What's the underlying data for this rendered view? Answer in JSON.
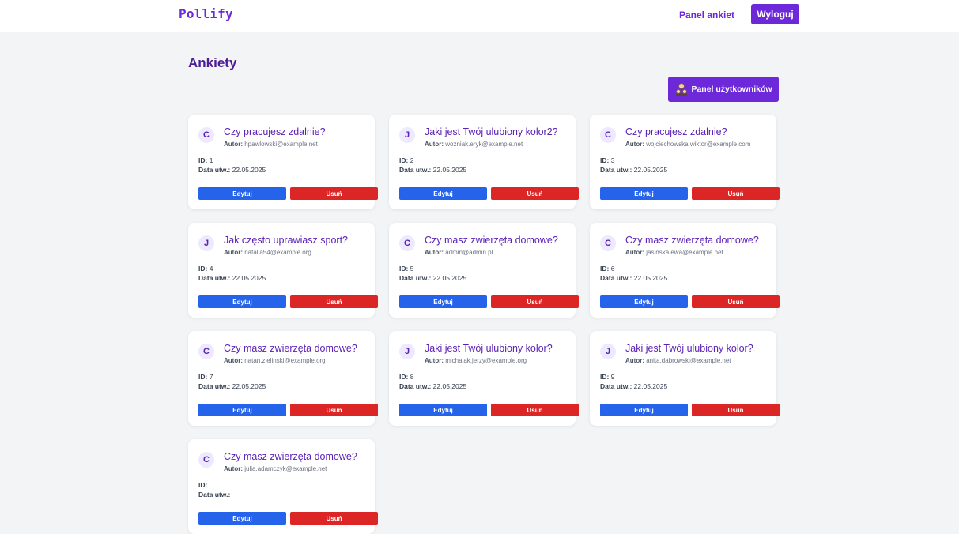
{
  "brand": "Pollify",
  "nav": {
    "panel_link": "Panel ankiet",
    "logout": "Wyloguj"
  },
  "page_title": "Ankiety",
  "users_button": "Panel użytkowników",
  "labels": {
    "author": "Autor:",
    "id": "ID:",
    "created": "Data utw.:",
    "edit": "Edytuj",
    "delete": "Usuń"
  },
  "colors": {
    "accent": "#6d28d9",
    "edit": "#2563eb",
    "delete": "#dc2626"
  },
  "surveys": [
    {
      "initial": "C",
      "title": "Czy pracujesz zdalnie?",
      "author": "hpawlowski@example.net",
      "id": "1",
      "created": "22.05.2025"
    },
    {
      "initial": "J",
      "title": "Jaki jest Twój ulubiony kolor2?",
      "author": "wozniak.eryk@example.net",
      "id": "2",
      "created": "22.05.2025"
    },
    {
      "initial": "C",
      "title": "Czy pracujesz zdalnie?",
      "author": "wojciechowska.wiktor@example.com",
      "id": "3",
      "created": "22.05.2025"
    },
    {
      "initial": "J",
      "title": "Jak często uprawiasz sport?",
      "author": "natalia54@example.org",
      "id": "4",
      "created": "22.05.2025"
    },
    {
      "initial": "C",
      "title": "Czy masz zwierzęta domowe?",
      "author": "admin@admin.pl",
      "id": "5",
      "created": "22.05.2025"
    },
    {
      "initial": "C",
      "title": "Czy masz zwierzęta domowe?",
      "author": "jasinska.ewa@example.net",
      "id": "6",
      "created": "22.05.2025"
    },
    {
      "initial": "C",
      "title": "Czy masz zwierzęta domowe?",
      "author": "natan.zielinski@example.org",
      "id": "7",
      "created": "22.05.2025"
    },
    {
      "initial": "J",
      "title": "Jaki jest Twój ulubiony kolor?",
      "author": "michalak.jerzy@example.org",
      "id": "8",
      "created": "22.05.2025"
    },
    {
      "initial": "J",
      "title": "Jaki jest Twój ulubiony kolor?",
      "author": "anita.dabrowski@example.net",
      "id": "9",
      "created": "22.05.2025"
    },
    {
      "initial": "C",
      "title": "Czy masz zwierzęta domowe?",
      "author": "julia.adamczyk@example.net",
      "id": "",
      "created": ""
    }
  ]
}
